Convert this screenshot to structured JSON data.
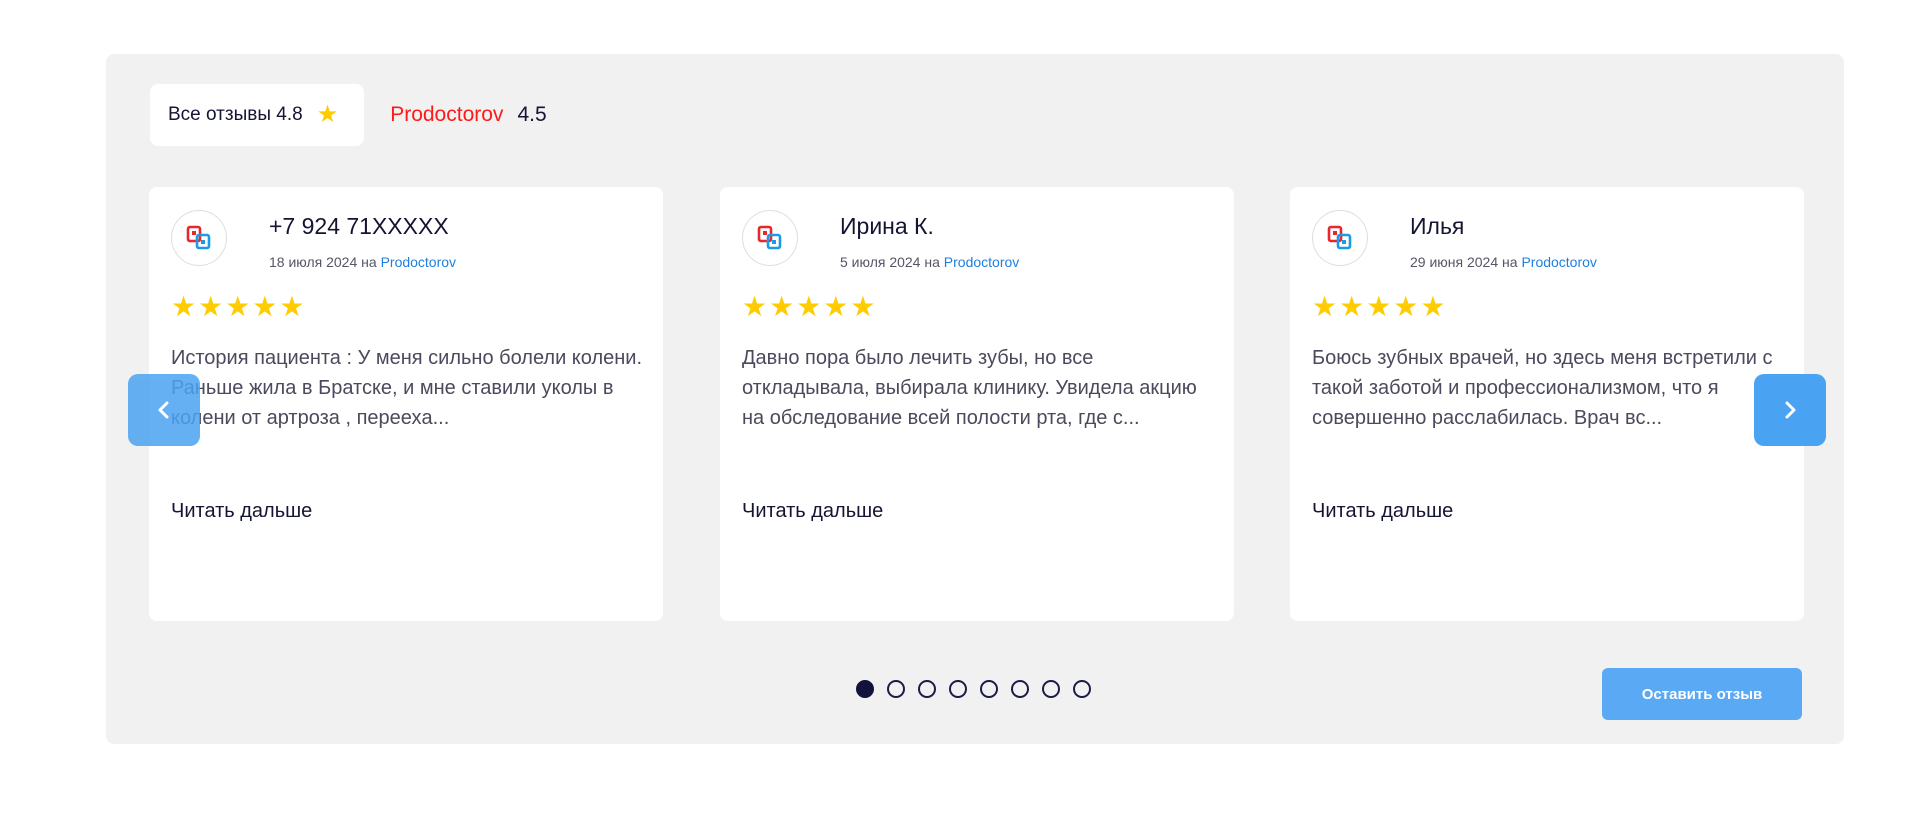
{
  "tabs": {
    "all_label": "Все отзывы 4.8",
    "source_name": "Prodoctorov",
    "source_rating": "4.5"
  },
  "colors": {
    "accent": "#4aa3f2",
    "star": "#ffcc00",
    "source_red": "#ff1a1a",
    "panel": "#f1f1f1"
  },
  "reviews": [
    {
      "author": "+7 924 71XXXXX",
      "date": "18 июля 2024 на",
      "source": "Prodoctorov",
      "stars": "★★★★★",
      "rating": 5,
      "text": "История пациента : У меня сильно болели колени. Раньше жила в Братске, и мне ставили уколы в колени от артроза , переехa...",
      "read_more": "Читать дальше"
    },
    {
      "author": "Ирина К.",
      "date": "5 июля 2024 на",
      "source": "Prodoctorov",
      "stars": "★★★★★",
      "rating": 5,
      "text": "Давно пора было лечить зубы, но все откладывала, выбирала клинику. Увидела акцию на обследование всей полости рта, где с...",
      "read_more": "Читать дальше"
    },
    {
      "author": "Илья",
      "date": "29 июня 2024 на",
      "source": "Prodoctorov",
      "stars": "★★★★★",
      "rating": 5,
      "text": "Боюсь зубных врачей, но здесь меня встретили с такой заботой и профессионализмом, что я совершенно расслабилась. Врач вс...",
      "read_more": "Читать дальше"
    }
  ],
  "pagination": {
    "total": 8,
    "current": 1
  },
  "leave_review_label": "Оставить отзыв",
  "icons": {
    "prev": "chevron-left-icon",
    "next": "chevron-right-icon",
    "tab_star": "star-icon",
    "avatar": "prodoctorov-logo-icon"
  }
}
